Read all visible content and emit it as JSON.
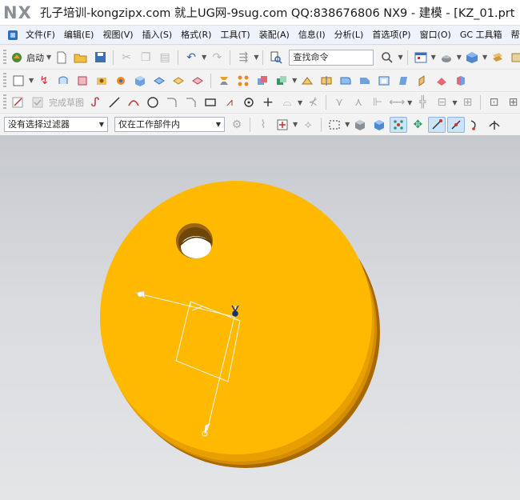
{
  "app": {
    "logo": "NX",
    "title": "孔子培训-kongzipx.com 就上UG网-9sug.com QQ:838676806 NX9 - 建模 - [KZ_01.prt"
  },
  "menu": {
    "items": [
      {
        "label": "文件(F)"
      },
      {
        "label": "编辑(E)"
      },
      {
        "label": "视图(V)"
      },
      {
        "label": "插入(S)"
      },
      {
        "label": "格式(R)"
      },
      {
        "label": "工具(T)"
      },
      {
        "label": "装配(A)"
      },
      {
        "label": "信息(I)"
      },
      {
        "label": "分析(L)"
      },
      {
        "label": "首选项(P)"
      },
      {
        "label": "窗口(O)"
      },
      {
        "label": "GC 工具箱"
      },
      {
        "label": "帮"
      }
    ]
  },
  "toolbar1": {
    "start_label": "启动",
    "search_placeholder": "查找命令"
  },
  "toolbar3": {
    "finish_sketch_label": "完成草图"
  },
  "toolbar4": {
    "selection_filter": "没有选择过滤器",
    "selection_scope": "仅在工作部件内"
  },
  "viewport": {
    "background": "#d6d8dc",
    "part_color": "#ffba00",
    "part_side_color": "#e09a00",
    "hole_color": "#8a5a10",
    "csys_color": "#f4f4f4"
  }
}
